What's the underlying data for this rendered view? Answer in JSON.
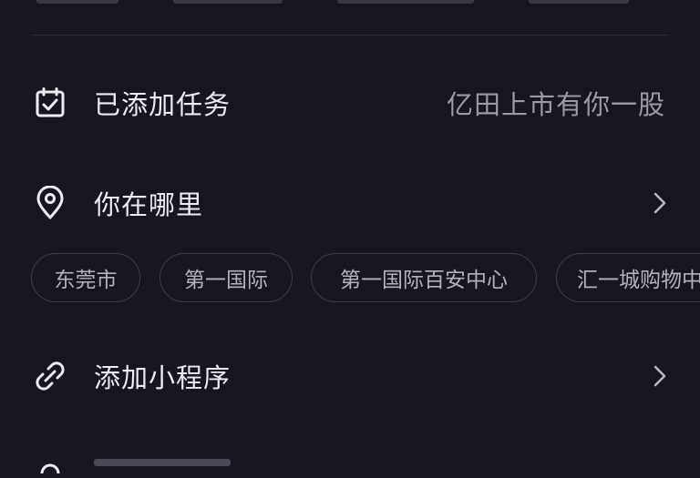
{
  "task_row": {
    "label": "已添加任务",
    "value": "亿田上市有你一股",
    "icon": "calendar-check-icon"
  },
  "location_row": {
    "label": "你在哪里",
    "icon": "location-pin-icon"
  },
  "location_chips": [
    {
      "label": "东莞市"
    },
    {
      "label": "第一国际"
    },
    {
      "label": "第一国际百安中心"
    },
    {
      "label": "汇一城购物中"
    }
  ],
  "miniprogram_row": {
    "label": "添加小程序",
    "icon": "link-icon"
  },
  "colors": {
    "background": "#16161f",
    "text": "#ececf2",
    "muted": "#9a9aa6",
    "chip_border": "#3d3d4a"
  }
}
